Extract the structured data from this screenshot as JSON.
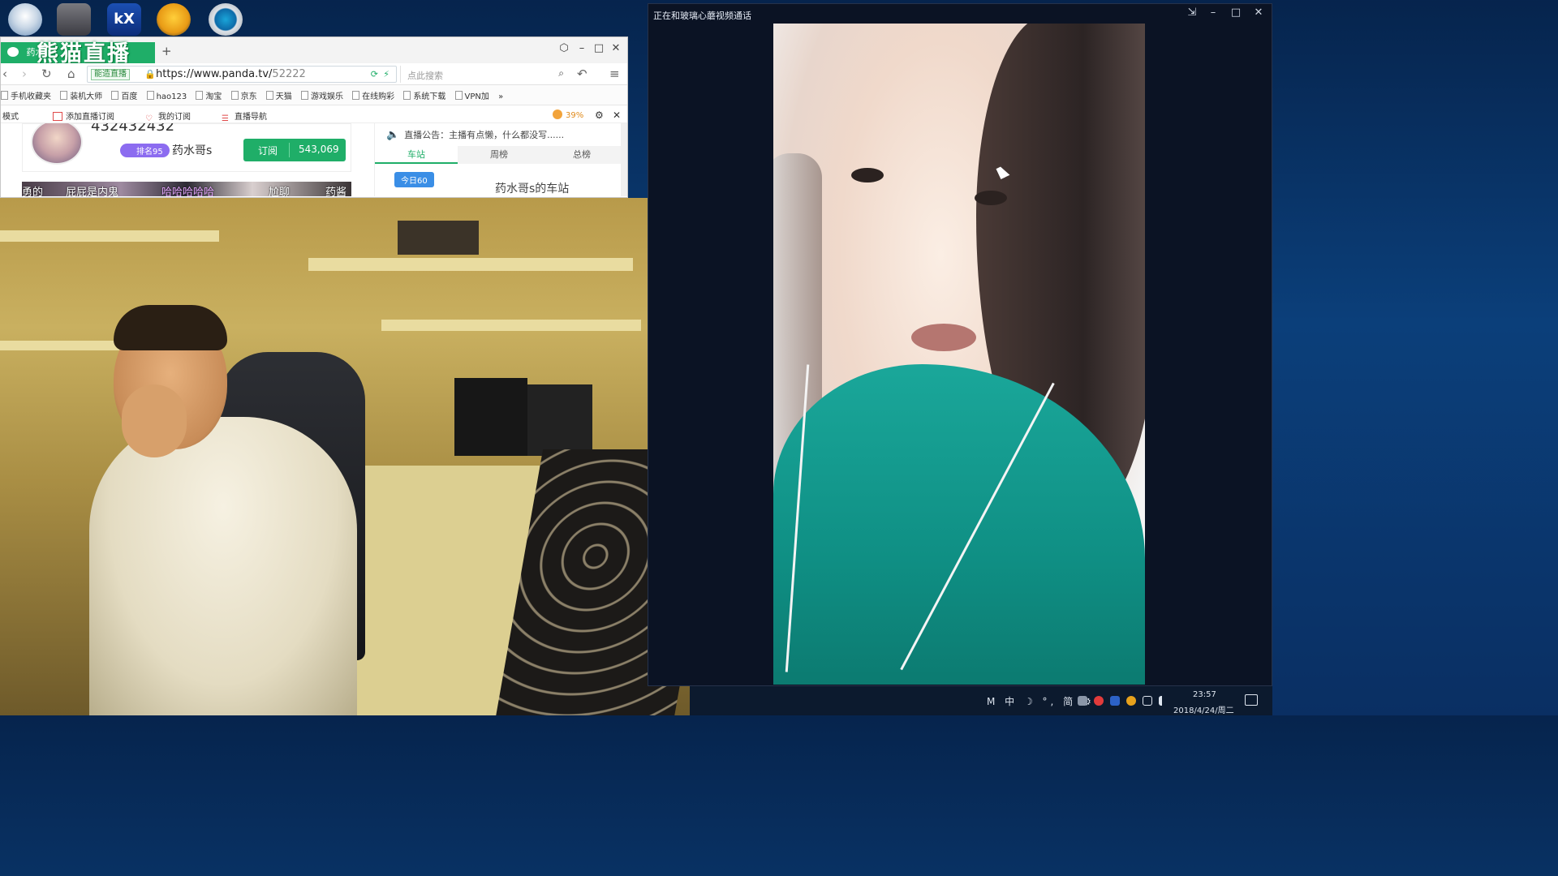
{
  "desktop": {
    "icons": [
      "app-icon",
      "app-icon",
      "kx-app-icon",
      "game-icon",
      "settings-app-icon"
    ],
    "kx_label": "kX"
  },
  "browser": {
    "tab_title": "药水",
    "tab_logo_text": "熊猫直播",
    "new_tab": "+",
    "speed_badge": "能造直播",
    "url_host": "https://www.panda.tv/",
    "url_path": "52222",
    "search_placeholder": "点此搜索",
    "bookmarks": [
      "手机收藏夹",
      "装机大师",
      "百度",
      "hao123",
      "淘宝",
      "京东",
      "天猫",
      "游戏娱乐",
      "在线购彩",
      "系统下载",
      "VPN加"
    ],
    "bookmarks_more": "»",
    "plugin_bar": {
      "mode": "模式",
      "add_sub": "添加直播订阅",
      "my_sub": "我的订阅",
      "live_nav": "直播导航",
      "percent": "39%"
    },
    "room": {
      "room_id": "432432432",
      "rank_badge": "排名95",
      "host_name": "药水哥s",
      "subscribe_label": "订阅",
      "subscribe_count": "543,069"
    },
    "thumb_texts": [
      "勇的",
      "屁屁是内鬼",
      "哈哈哈哈哈",
      "尬聊",
      "药酱"
    ],
    "panel": {
      "notice": "直播公告：主播有点懒，什么都没写......",
      "tabs": [
        "车站",
        "周榜",
        "总榜"
      ],
      "today_badge": "今日60",
      "station_title": "药水哥s的车站"
    }
  },
  "call_window": {
    "title": "正在和玻璃心蘑视频通话",
    "controls": [
      "pin-icon",
      "minimize-icon",
      "maximize-icon",
      "close-icon"
    ]
  },
  "taskbar": {
    "ime_text": "M 中 ☽ °, 简 ⚙",
    "time": "23:57",
    "date": "2018/4/24/周二"
  },
  "colors": {
    "panda_green": "#1fae68",
    "taskbar_bg": "#0c1a2e",
    "desktop_blue": "#0b3f7a"
  }
}
